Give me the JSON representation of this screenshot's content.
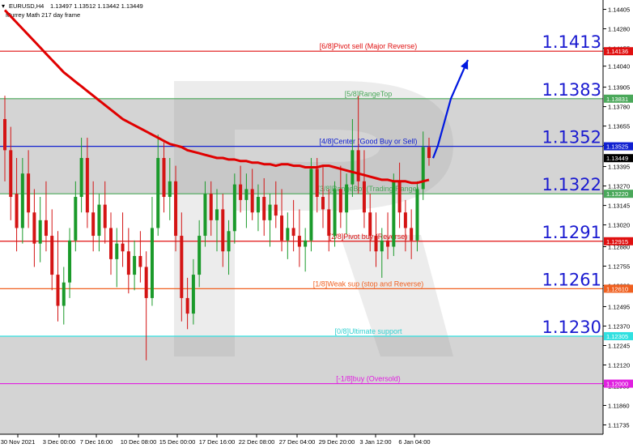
{
  "header": {
    "symbol": "EURUSD,H4",
    "ohlc": "1.13497 1.13512 1.13442 1.13449",
    "indicator": "Murrey Math 217 day frame"
  },
  "colors": {
    "background": "#ffffff",
    "range_band": "#d4d4d4",
    "bull": "#1a9a2a",
    "bear": "#d41414",
    "ma": "#e00000",
    "arrow": "#0018e0",
    "price_tag": "#000000"
  },
  "levels": [
    {
      "id": "p68",
      "label": "[6/8]Pivot sell (Major Reverse)",
      "price": 1.14136,
      "tag": "1.14136",
      "big": "1.1413",
      "color": "#e01010",
      "text_color": "#e01010"
    },
    {
      "id": "p58",
      "label": "[5/8]RangeTop",
      "price": 1.13831,
      "tag": "1.13831",
      "big": "1.1383",
      "color": "#4aa85a",
      "text_color": "#4aa85a"
    },
    {
      "id": "p48",
      "label": "[4/8]Center (Good Buy or Sell)",
      "price": 1.13525,
      "tag": "1.13525",
      "big": "1.1352",
      "color": "#1020d0",
      "text_color": "#1020d0"
    },
    {
      "id": "p38",
      "label": "[3/8]RangeBot (Trading Range)",
      "price": 1.1322,
      "tag": "1.13220",
      "big": "1.1322",
      "color": "#4aa85a",
      "text_color": "#4aa85a"
    },
    {
      "id": "p28",
      "label": "[2/8]Pivot buy (Reverse)",
      "price": 1.12915,
      "tag": "1.12915",
      "big": "1.1291",
      "color": "#e01010",
      "text_color": "#e01010"
    },
    {
      "id": "p18",
      "label": "[1/8]Weak sup (stop and Reverse)",
      "price": 1.1261,
      "tag": "1.12610",
      "big": "1.1261",
      "color": "#f06020",
      "text_color": "#f06020"
    },
    {
      "id": "p08",
      "label": "[0/8]Ultimate support",
      "price": 1.12305,
      "tag": "1.12305",
      "big": "1.1230",
      "color": "#30e0e0",
      "text_color": "#30d0d0"
    },
    {
      "id": "m18",
      "label": "[-1/8]buy (Oversold)",
      "price": 1.12,
      "tag": "1.12000",
      "big": "",
      "color": "#e020e0",
      "text_color": "#e020e0"
    }
  ],
  "current_price": {
    "price": 1.13449,
    "tag": "1.13449"
  },
  "chart_data": {
    "type": "candlestick",
    "ylim": [
      1.11675,
      1.14465
    ],
    "y_ticks": [
      {
        "v": 1.14405,
        "label": "1.14405"
      },
      {
        "v": 1.1428,
        "label": "1.14280"
      },
      {
        "v": 1.14155,
        "label": "1.14155"
      },
      {
        "v": 1.1404,
        "label": "1.14040"
      },
      {
        "v": 1.13905,
        "label": "1.13905"
      },
      {
        "v": 1.1378,
        "label": "1.13780"
      },
      {
        "v": 1.13655,
        "label": "1.13655"
      },
      {
        "v": 1.1353,
        "label": "1.13530"
      },
      {
        "v": 1.13395,
        "label": "1.13395"
      },
      {
        "v": 1.1327,
        "label": "1.13270"
      },
      {
        "v": 1.13145,
        "label": "1.13145"
      },
      {
        "v": 1.1302,
        "label": "1.13020"
      },
      {
        "v": 1.1288,
        "label": "1.12880"
      },
      {
        "v": 1.12755,
        "label": "1.12755"
      },
      {
        "v": 1.1263,
        "label": "1.12630"
      },
      {
        "v": 1.12495,
        "label": "1.12495"
      },
      {
        "v": 1.1237,
        "label": "1.12370"
      },
      {
        "v": 1.12245,
        "label": "1.12245"
      },
      {
        "v": 1.1212,
        "label": "1.12120"
      },
      {
        "v": 1.11985,
        "label": "1.11985"
      },
      {
        "v": 1.1186,
        "label": "1.11860"
      },
      {
        "v": 1.11735,
        "label": "1.11735"
      }
    ],
    "x_labels": [
      "30 Nov 2021",
      "3 Dec 00:00",
      "7 Dec 16:00",
      "10 Dec 08:00",
      "15 Dec 00:00",
      "17 Dec 16:00",
      "22 Dec 08:00",
      "27 Dec 04:00",
      "29 Dec 20:00",
      "3 Jan 12:00",
      "6 Jan 04:00"
    ],
    "candles": [
      [
        1.137,
        1.1385,
        1.133,
        1.135
      ],
      [
        1.135,
        1.1365,
        1.1305,
        1.132
      ],
      [
        1.1322,
        1.1345,
        1.1285,
        1.13
      ],
      [
        1.13,
        1.1345,
        1.129,
        1.1335
      ],
      [
        1.1335,
        1.135,
        1.13,
        1.131
      ],
      [
        1.131,
        1.1325,
        1.1275,
        1.129
      ],
      [
        1.129,
        1.132,
        1.1278,
        1.1305
      ],
      [
        1.1305,
        1.133,
        1.1285,
        1.1295
      ],
      [
        1.1295,
        1.1312,
        1.126,
        1.127
      ],
      [
        1.127,
        1.1298,
        1.124,
        1.125
      ],
      [
        1.125,
        1.1275,
        1.1238,
        1.1265
      ],
      [
        1.1265,
        1.13,
        1.1255,
        1.1292
      ],
      [
        1.1292,
        1.133,
        1.1285,
        1.132
      ],
      [
        1.132,
        1.1358,
        1.131,
        1.1345
      ],
      [
        1.1345,
        1.1358,
        1.13,
        1.131
      ],
      [
        1.131,
        1.133,
        1.1285,
        1.1295
      ],
      [
        1.1295,
        1.1322,
        1.1285,
        1.1315
      ],
      [
        1.1315,
        1.133,
        1.129,
        1.13
      ],
      [
        1.13,
        1.131,
        1.127,
        1.128
      ],
      [
        1.128,
        1.13,
        1.1262,
        1.129
      ],
      [
        1.129,
        1.131,
        1.1275,
        1.1285
      ],
      [
        1.1285,
        1.13,
        1.1258,
        1.127
      ],
      [
        1.127,
        1.1292,
        1.126,
        1.1282
      ],
      [
        1.1282,
        1.1298,
        1.1265,
        1.1275
      ],
      [
        1.1275,
        1.1285,
        1.1215,
        1.1255
      ],
      [
        1.1255,
        1.132,
        1.125,
        1.13
      ],
      [
        1.13,
        1.136,
        1.1295,
        1.1345
      ],
      [
        1.1345,
        1.1355,
        1.131,
        1.132
      ],
      [
        1.132,
        1.1345,
        1.1305,
        1.133
      ],
      [
        1.133,
        1.134,
        1.1285,
        1.1295
      ],
      [
        1.1295,
        1.131,
        1.124,
        1.1255
      ],
      [
        1.1255,
        1.1268,
        1.1235,
        1.1245
      ],
      [
        1.1245,
        1.128,
        1.1238,
        1.127
      ],
      [
        1.127,
        1.1305,
        1.1262,
        1.1295
      ],
      [
        1.1295,
        1.133,
        1.1288,
        1.1322
      ],
      [
        1.1322,
        1.133,
        1.1295,
        1.1305
      ],
      [
        1.1305,
        1.1325,
        1.1285,
        1.1312
      ],
      [
        1.1312,
        1.1322,
        1.1275,
        1.1285
      ],
      [
        1.1285,
        1.1305,
        1.127,
        1.1298
      ],
      [
        1.1298,
        1.1335,
        1.129,
        1.1328
      ],
      [
        1.1328,
        1.134,
        1.131,
        1.1318
      ],
      [
        1.1318,
        1.1335,
        1.13,
        1.1325
      ],
      [
        1.1325,
        1.1338,
        1.1305,
        1.131
      ],
      [
        1.131,
        1.1328,
        1.1298,
        1.132
      ],
      [
        1.132,
        1.1332,
        1.1295,
        1.1305
      ],
      [
        1.1305,
        1.1322,
        1.1288,
        1.1315
      ],
      [
        1.1315,
        1.133,
        1.13,
        1.1308
      ],
      [
        1.1308,
        1.1325,
        1.1285,
        1.1292
      ],
      [
        1.1292,
        1.131,
        1.128,
        1.13
      ],
      [
        1.13,
        1.1318,
        1.1285,
        1.1295
      ],
      [
        1.1295,
        1.1312,
        1.1275,
        1.1288
      ],
      [
        1.1288,
        1.13,
        1.1272,
        1.1292
      ],
      [
        1.1292,
        1.1345,
        1.1285,
        1.1338
      ],
      [
        1.1338,
        1.1345,
        1.131,
        1.132
      ],
      [
        1.132,
        1.134,
        1.13,
        1.1312
      ],
      [
        1.1312,
        1.1325,
        1.1285,
        1.1295
      ],
      [
        1.1295,
        1.133,
        1.1288,
        1.1325
      ],
      [
        1.1325,
        1.134,
        1.13,
        1.131
      ],
      [
        1.131,
        1.1335,
        1.1296,
        1.1328
      ],
      [
        1.1328,
        1.137,
        1.132,
        1.135
      ],
      [
        1.135,
        1.1385,
        1.1322,
        1.133
      ],
      [
        1.133,
        1.135,
        1.13,
        1.131
      ],
      [
        1.131,
        1.1322,
        1.1285,
        1.1295
      ],
      [
        1.1295,
        1.131,
        1.1275,
        1.1285
      ],
      [
        1.1285,
        1.13,
        1.1268,
        1.1292
      ],
      [
        1.1292,
        1.131,
        1.128,
        1.1288
      ],
      [
        1.1288,
        1.1335,
        1.1282,
        1.133
      ],
      [
        1.133,
        1.1342,
        1.13,
        1.131
      ],
      [
        1.131,
        1.1318,
        1.1285,
        1.13
      ],
      [
        1.13,
        1.1312,
        1.128,
        1.1292
      ],
      [
        1.1292,
        1.133,
        1.1285,
        1.1325
      ],
      [
        1.1325,
        1.1362,
        1.1318,
        1.1352
      ],
      [
        1.1352,
        1.1358,
        1.134,
        1.1345
      ]
    ],
    "ma_line": [
      1.144,
      1.1436,
      1.1432,
      1.1428,
      1.1424,
      1.142,
      1.1416,
      1.1412,
      1.1408,
      1.1404,
      1.14,
      1.1397,
      1.1394,
      1.1391,
      1.1388,
      1.1385,
      1.1382,
      1.1379,
      1.1376,
      1.1373,
      1.137,
      1.1368,
      1.1366,
      1.1364,
      1.1362,
      1.136,
      1.1358,
      1.1356,
      1.1354,
      1.1353,
      1.1352,
      1.135,
      1.1349,
      1.1348,
      1.1347,
      1.1346,
      1.1345,
      1.1345,
      1.1344,
      1.1344,
      1.1343,
      1.1343,
      1.1342,
      1.1342,
      1.1341,
      1.1341,
      1.134,
      1.1341,
      1.1341,
      1.134,
      1.134,
      1.1339,
      1.1339,
      1.1339,
      1.134,
      1.134,
      1.1339,
      1.1338,
      1.1337,
      1.1336,
      1.1335,
      1.1334,
      1.1333,
      1.1332,
      1.1331,
      1.1331,
      1.133,
      1.133,
      1.133,
      1.1329,
      1.1329,
      1.133,
      1.1331
    ],
    "forecast_arrow": [
      [
        1.13449,
        1.1353
      ],
      [
        1.1353,
        1.13831
      ],
      [
        1.13831,
        1.1408
      ]
    ]
  }
}
